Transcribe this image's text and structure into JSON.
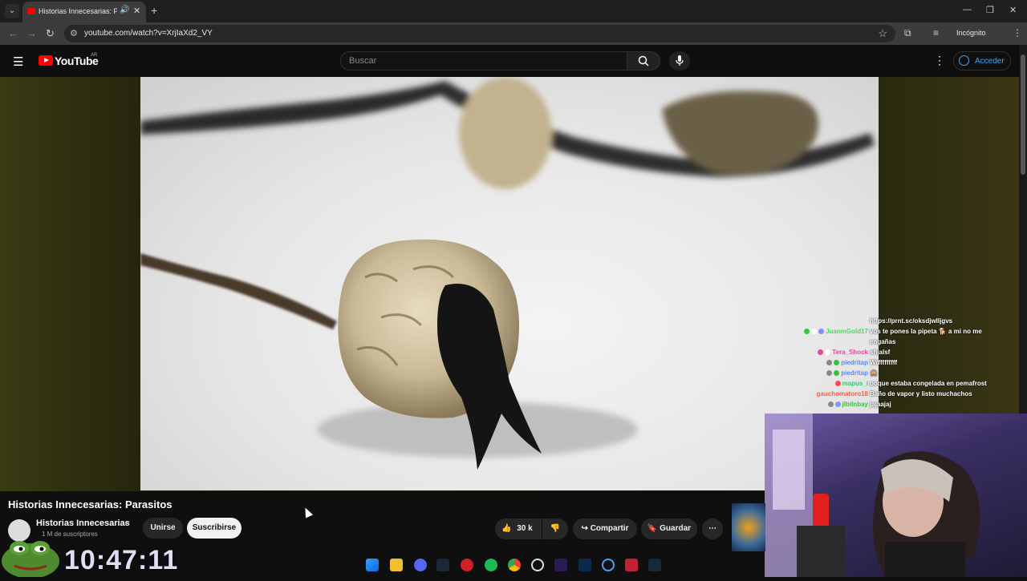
{
  "browser": {
    "tab_title": "Historias Innecesarias: Paras",
    "url": "youtube.com/watch?v=XrjIaXd2_VY",
    "incognito_label": "Incógnito"
  },
  "youtube": {
    "logo_text": "YouTube",
    "country_code": "AR",
    "search_placeholder": "Buscar",
    "sign_in_label": "Acceder"
  },
  "video": {
    "title": "Historias Innecesarias: Parasitos",
    "channel_name": "Historias Innecesarias",
    "channel_subs": "1 M de suscriptores",
    "join_label": "Unirse",
    "subscribe_label": "Suscribirse",
    "likes": "30 k",
    "share_label": "Compartir",
    "save_label": "Guardar"
  },
  "chat": [
    {
      "user": "",
      "user_color": "#ffffff",
      "msg": "https://prnt.sc/oksdjwlljgvs",
      "badges": []
    },
    {
      "user": "JuanmGold17",
      "user_color": "#4cd964",
      "msg": "vos te pones la pipeta 🐕 a mi no me",
      "badges": [
        "#2ecc40",
        "#ffffff",
        "#8a8aff"
      ]
    },
    {
      "user": "",
      "user_color": "#ffffff",
      "msg": "engañas",
      "badges": []
    },
    {
      "user": "Tera_Shock",
      "user_color": "#e34b9e",
      "msg": "shjalsf",
      "badges": [
        "#e34b9e",
        "#ffffff"
      ]
    },
    {
      "user": "piedritap",
      "user_color": "#5a8aff",
      "msg": "Wtfffffffff",
      "badges": [
        "#888888",
        "#3cbf3c"
      ]
    },
    {
      "user": "piedritap",
      "user_color": "#5a8aff",
      "msg": "🙊",
      "badges": [
        "#888888",
        "#3cbf3c"
      ]
    },
    {
      "user": "mapus_i",
      "user_color": "#2ecc71",
      "msg": "poque estaba congelada en pemafrost",
      "badges": [
        "#ff4a4a"
      ]
    },
    {
      "user": "gauchomatoro18",
      "user_color": "#ff5a4a",
      "msg": "Baño de vapor y listo muchachos",
      "badges": []
    },
    {
      "user": "jlbilnbay",
      "user_color": "#3cbf3c",
      "msg": "jajaajaj",
      "badges": [
        "#888888",
        "#7a9aff"
      ]
    }
  ],
  "overlay": {
    "timer": "10:47:11"
  },
  "colors": {
    "accent_blue": "#3ea6ff",
    "yt_red": "#ff0000",
    "timer_color": "#e3dcf5"
  }
}
